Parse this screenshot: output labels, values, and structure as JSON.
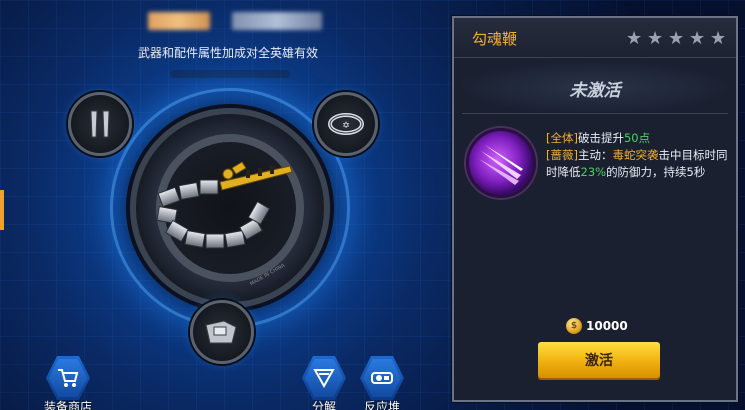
{
  "header": {
    "subtitle": "武器和配件属性加成对全英雄有效"
  },
  "center": {
    "stamp": "MADE IN CHINA"
  },
  "bottom_buttons": [
    {
      "label": "装备商店",
      "icon": "cart-icon"
    },
    {
      "label": "分解",
      "icon": "decompose-icon"
    },
    {
      "label": "反应堆",
      "icon": "reactor-icon"
    }
  ],
  "panel": {
    "title": "勾魂鞭",
    "stars": 5,
    "status": "未激活",
    "desc": {
      "line1_tag": "[全体]",
      "line1_text": "破击提升",
      "line1_value": "50点",
      "line2_tag": "[蔷薇]",
      "line2_text_a": "主动：",
      "line2_skill": "毒蛇突袭",
      "line2_text_b": "击中目标时同时降低",
      "line2_value": "23%",
      "line2_text_c": "的防御力，持续5秒"
    },
    "cost": "10000",
    "activate_label": "激活"
  },
  "colors": {
    "accent_gold": "#f0b030",
    "highlight_green": "#50d060",
    "panel_bg": "#1a2030"
  }
}
